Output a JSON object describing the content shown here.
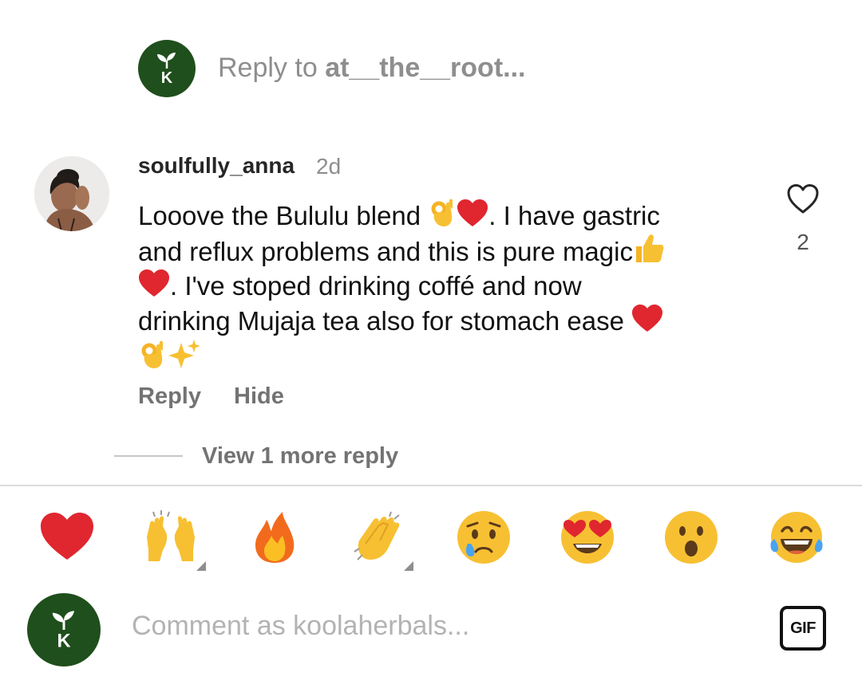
{
  "reply_banner": {
    "prefix": "Reply to ",
    "username": "at__the__root..."
  },
  "comment": {
    "username": "soulfully_anna",
    "timestamp": "2d",
    "lines": [
      "Looove the Bululu blend ",
      ". I have gastric",
      "and reflux problems and this is pure magic",
      ". I've stoped drinking coffé and now",
      "drinking Mujaja tea also for stomach ease "
    ],
    "like_count": "2",
    "actions": {
      "reply": "Reply",
      "hide": "Hide"
    },
    "view_more": "View 1 more reply"
  },
  "emoji_bar": [
    "red-heart",
    "raising-hands",
    "fire",
    "clapping-hands",
    "crying-face",
    "heart-eyes-face",
    "surprised-face",
    "tears-of-joy-face"
  ],
  "composer": {
    "placeholder": "Comment as koolaherbals...",
    "gif_label": "GIF"
  },
  "colors": {
    "brand_green": "#1f4f1c",
    "muted_text": "#8e8e8e",
    "heart_red": "#e0262f"
  }
}
